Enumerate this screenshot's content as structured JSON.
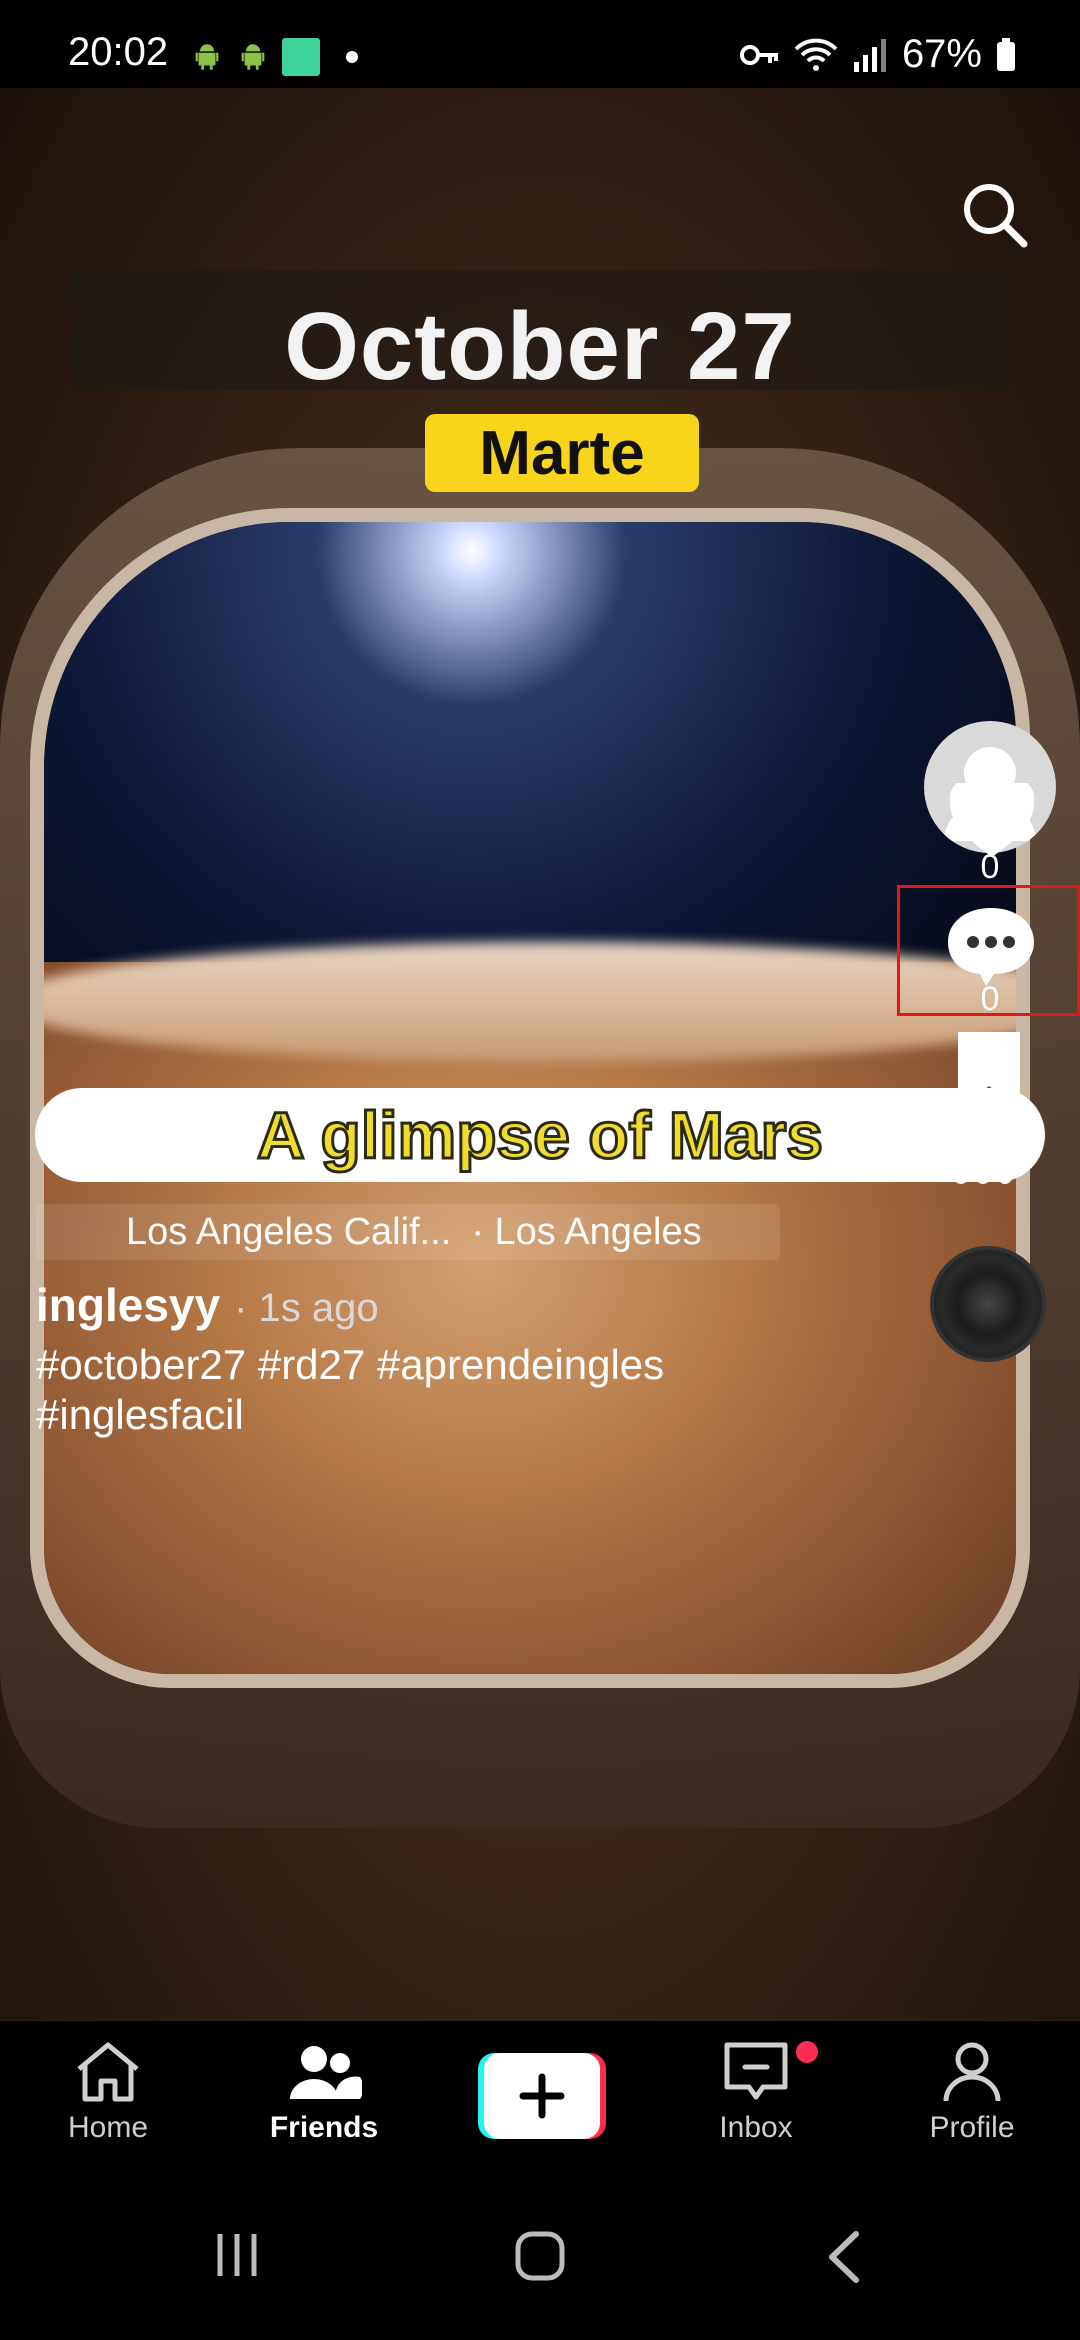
{
  "status_bar": {
    "time": "20:02",
    "battery": "67%"
  },
  "video": {
    "date_title": "October 27",
    "tag_label": "Marte",
    "caption": "A glimpse of Mars",
    "location_primary": "Los Angeles Calif...",
    "location_secondary": "· Los Angeles"
  },
  "post": {
    "username": "inglesyy",
    "time_ago": "· 1s ago",
    "hashtags": "#october27 #rd27 #aprendeingles #inglesfacil"
  },
  "rail": {
    "likes": "0",
    "comments": "0",
    "saves": "0"
  },
  "bottom_nav": {
    "home": "Home",
    "friends": "Friends",
    "inbox": "Inbox",
    "profile": "Profile"
  },
  "colors": {
    "accent_red": "#fe2c55",
    "accent_cyan": "#25f4ee",
    "highlight": "#e01818",
    "tag_yellow": "#f8d41a"
  }
}
